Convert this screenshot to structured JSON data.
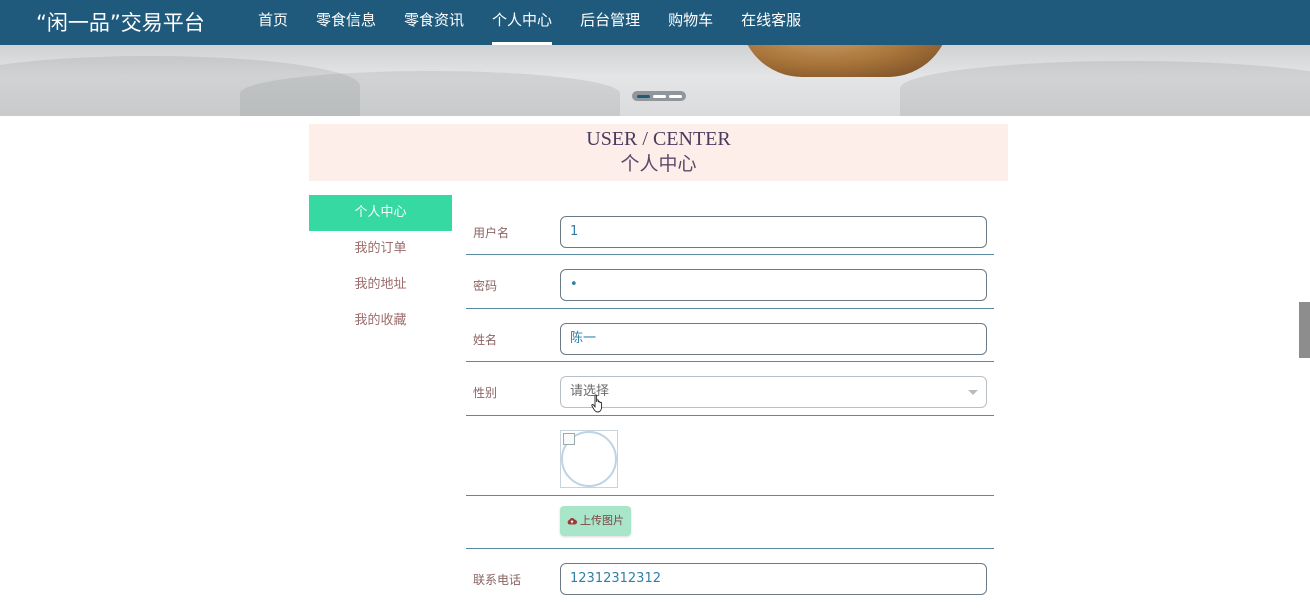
{
  "header": {
    "brand": "“闲一品”交易平台",
    "nav": [
      {
        "label": "首页"
      },
      {
        "label": "零食信息"
      },
      {
        "label": "零食资讯"
      },
      {
        "label": "个人中心",
        "active": true
      },
      {
        "label": "后台管理"
      },
      {
        "label": "购物车"
      },
      {
        "label": "在线客服"
      }
    ]
  },
  "title": {
    "en": "USER / CENTER",
    "cn": "个人中心"
  },
  "sidebar": {
    "items": [
      {
        "label": "个人中心"
      },
      {
        "label": "我的订单"
      },
      {
        "label": "我的地址"
      },
      {
        "label": "我的收藏"
      }
    ]
  },
  "form": {
    "username": {
      "label": "用户名",
      "value": "1"
    },
    "password": {
      "label": "密码",
      "value": "•"
    },
    "name": {
      "label": "姓名",
      "value": "陈一"
    },
    "gender": {
      "label": "性别",
      "placeholder": "请选择"
    },
    "upload_label": "上传图片",
    "phone": {
      "label": "联系电话",
      "value": "12312312312"
    }
  },
  "colors": {
    "header_bg": "#1f5a7d",
    "accent": "#36d9a2",
    "title_bg": "#fdeeea"
  }
}
